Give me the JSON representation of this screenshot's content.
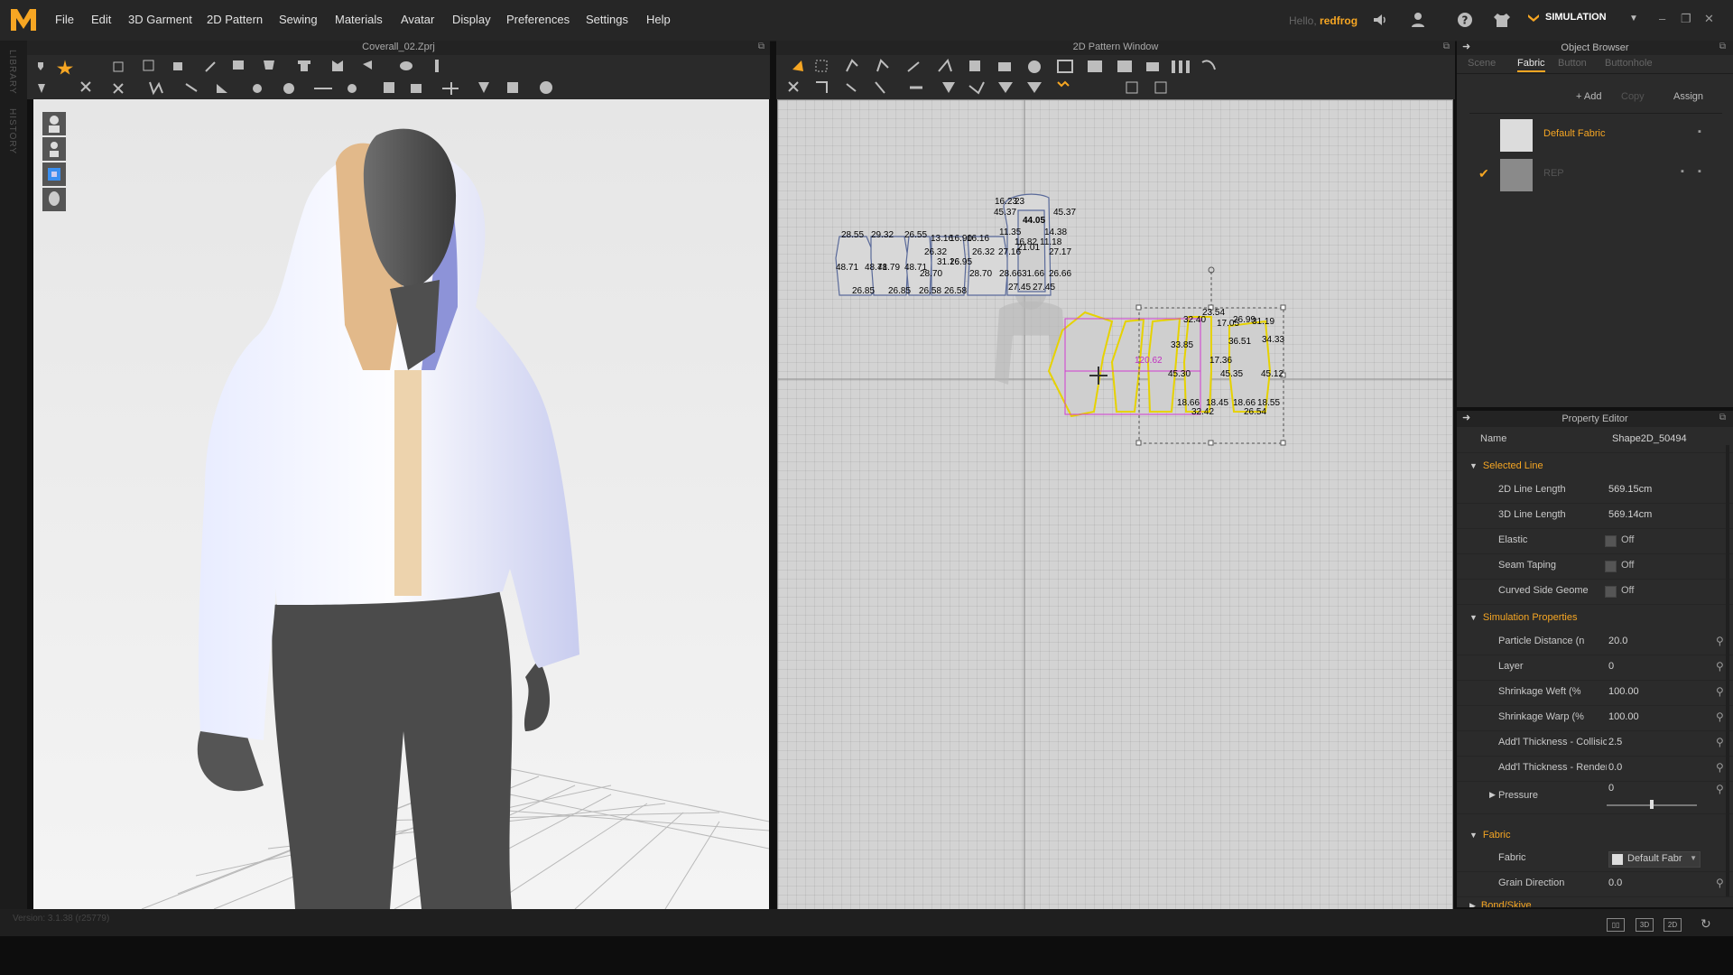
{
  "app": {
    "logo_letter": "M",
    "accent": "#f6a623",
    "menu": [
      "File",
      "Edit",
      "3D Garment",
      "2D Pattern",
      "Sewing",
      "Materials",
      "Avatar",
      "Display",
      "Preferences",
      "Settings",
      "Help"
    ],
    "hello": "Hello,",
    "user": "redfrog",
    "mode": "SIMULATION",
    "window_controls": [
      "–",
      "❐",
      "✕"
    ]
  },
  "left_strip": [
    "LIBRARY",
    "HISTORY"
  ],
  "window3d": {
    "title": "Coverall_02.Zprj"
  },
  "window2d": {
    "title": "2D Pattern Window",
    "measurements": {
      "blue_top": [
        "16.23",
        "23",
        "45.37",
        "45.37",
        "44.05",
        "11.35",
        "14.38",
        "16.82",
        "11.18",
        "27.17",
        "21.01",
        "27.16",
        "26.66",
        "28.66",
        "26.32",
        "28.70",
        "27.45",
        "27.45",
        "31.66"
      ],
      "blue_left": [
        "28.55",
        "29.32",
        "26.55",
        "48.71",
        "48.71",
        "48.79",
        "48.71",
        "26.85",
        "26.85",
        "13.16",
        "16.90",
        "26.32",
        "28.70",
        "26.58",
        "26.58",
        "31.16",
        "26.95",
        "16.16"
      ],
      "yellow": [
        "32.40",
        "23.54",
        "17.05",
        "26.99",
        "31.19",
        "33.85",
        "36.51",
        "34.33",
        "120.62",
        "17.36",
        "45.30",
        "45.35",
        "45.12",
        "18.66",
        "18.45",
        "18.66",
        "18.55",
        "32.42",
        "26.54"
      ]
    }
  },
  "object_browser": {
    "title": "Object Browser",
    "tabs": [
      "Scene",
      "Fabric",
      "Button",
      "Buttonhole"
    ],
    "active_tab": "Fabric",
    "buttons": {
      "add": "+ Add",
      "copy": "Copy",
      "assign": "Assign"
    },
    "fabrics": [
      {
        "name": "Default Fabric",
        "checked": false
      },
      {
        "name": "REP",
        "checked": true
      }
    ]
  },
  "property_editor": {
    "title": "Property Editor",
    "name_label": "Name",
    "name_value": "Shape2D_50494",
    "selected_line": {
      "header": "Selected Line",
      "rows": [
        {
          "label": "2D Line Length",
          "value": "569.15cm"
        },
        {
          "label": "3D Line Length",
          "value": "569.14cm"
        }
      ],
      "toggles": [
        {
          "label": "Elastic",
          "value": "Off"
        },
        {
          "label": "Seam Taping",
          "value": "Off"
        },
        {
          "label": "Curved Side Geome",
          "value": "Off"
        }
      ]
    },
    "simulation": {
      "header": "Simulation Properties",
      "rows": [
        {
          "label": "Particle Distance (n",
          "value": "20.0"
        },
        {
          "label": "Layer",
          "value": "0"
        },
        {
          "label": "Shrinkage Weft (%",
          "value": "100.00"
        },
        {
          "label": "Shrinkage Warp (%",
          "value": "100.00"
        },
        {
          "label": "Add'l Thickness - Collisic",
          "value": "2.5"
        },
        {
          "label": "Add'l Thickness - Render",
          "value": "0.0"
        }
      ],
      "pressure_label": "Pressure",
      "pressure_value": "0",
      "pressure_level": 0.5
    },
    "fabric": {
      "header": "Fabric",
      "fabric_label": "Fabric",
      "fabric_value": "Default Fabr",
      "grain_label": "Grain Direction",
      "grain_value": "0.0",
      "next_header": "Bond/Skive"
    }
  },
  "status": {
    "version": "Version: 3.1.38 (r25779)"
  }
}
